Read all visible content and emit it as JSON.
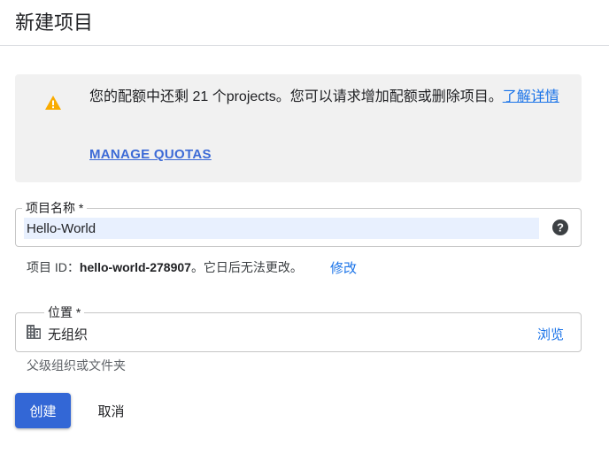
{
  "header": {
    "title": "新建项目"
  },
  "quota_notice": {
    "icon": "warning-icon",
    "message": "您的配额中还剩 21 个projects。您可以请求增加配额或删除项目。",
    "learn_more": "了解详情",
    "manage_quotas": "MANAGE QUOTAS"
  },
  "project_name": {
    "label": "项目名称 *",
    "value": "Hello-World",
    "help_icon": "help-circle-icon"
  },
  "project_id": {
    "prefix": "项目 ID：",
    "value": "hello-world-278907",
    "suffix": "。它日后无法更改。",
    "edit_label": "修改"
  },
  "location": {
    "label": "位置 *",
    "icon": "organization-icon",
    "value": "无组织",
    "browse_label": "浏览",
    "helper": "父级组织或文件夹"
  },
  "actions": {
    "create_label": "创建",
    "cancel_label": "取消"
  },
  "colors": {
    "primary": "#3367d6",
    "link": "#1a73e8",
    "warning": "#f9ab00",
    "notice_bg": "#f1f1f1"
  }
}
